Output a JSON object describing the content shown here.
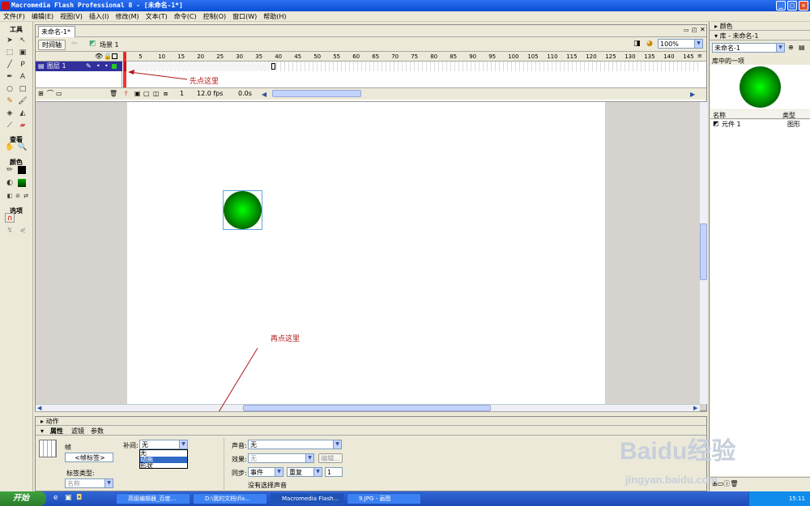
{
  "window": {
    "title": "Macromedia Flash Professional 8 - [未命名-1*]",
    "min": "_",
    "max": "□",
    "close": "✕"
  },
  "menu": [
    "文件(F)",
    "编辑(E)",
    "视图(V)",
    "插入(I)",
    "修改(M)",
    "文本(T)",
    "命令(C)",
    "控制(O)",
    "窗口(W)",
    "帮助(H)"
  ],
  "tools": {
    "header": "工具",
    "view_header": "查看",
    "color_header": "颜色",
    "options_header": "选项"
  },
  "document": {
    "tab": "未命名-1*",
    "timeline_button": "时间轴",
    "scene": "场景 1",
    "zoom": "100%"
  },
  "timeline": {
    "ruler": [
      "1",
      "5",
      "10",
      "15",
      "20",
      "25",
      "30",
      "35",
      "40",
      "45",
      "50",
      "55",
      "60",
      "65",
      "70",
      "75",
      "80",
      "85",
      "90",
      "95",
      "100",
      "105",
      "110",
      "115",
      "120",
      "125",
      "130",
      "135",
      "140",
      "145"
    ],
    "layer": "图层 1",
    "frame": "1",
    "fps": "12.0 fps",
    "time": "0.0s"
  },
  "annotations": {
    "first": "先点这里",
    "second": "再点这里"
  },
  "properties": {
    "actions_tab": "动作",
    "tabs": [
      "属性",
      "滤镜",
      "参数"
    ],
    "frame_label": "帧",
    "frame_name_placeholder": "<帧标签>",
    "label_type": "标签类型:",
    "label_type_value": "名称",
    "tween_label": "补间:",
    "tween_value": "无",
    "tween_options": [
      "无",
      "动画",
      "形状"
    ],
    "sound_label": "声音:",
    "sound_value": "无",
    "effect_label": "效果:",
    "effect_value": "无",
    "edit_button": "编辑...",
    "sync_label": "同步:",
    "sync_value": "事件",
    "repeat_value": "重复",
    "repeat_count": "1",
    "no_sound": "没有选择声音"
  },
  "panels": {
    "color_title": "颜色",
    "library_title": "库 - 未命名-1",
    "library_select": "未命名-1",
    "library_count": "库中的一项",
    "col_name": "名称",
    "col_type": "类型",
    "item_name": "元件 1",
    "item_type": "图形"
  },
  "taskbar": {
    "start": "开始",
    "tasks": [
      "高级编辑器_百度...",
      "D:\\我的文档\\fla...",
      "Macromedia Flash...",
      "9.JPG - 画图"
    ],
    "time": "15:11"
  },
  "watermark": {
    "brand": "Baidu经验",
    "url": "jingyan.baidu.com"
  }
}
